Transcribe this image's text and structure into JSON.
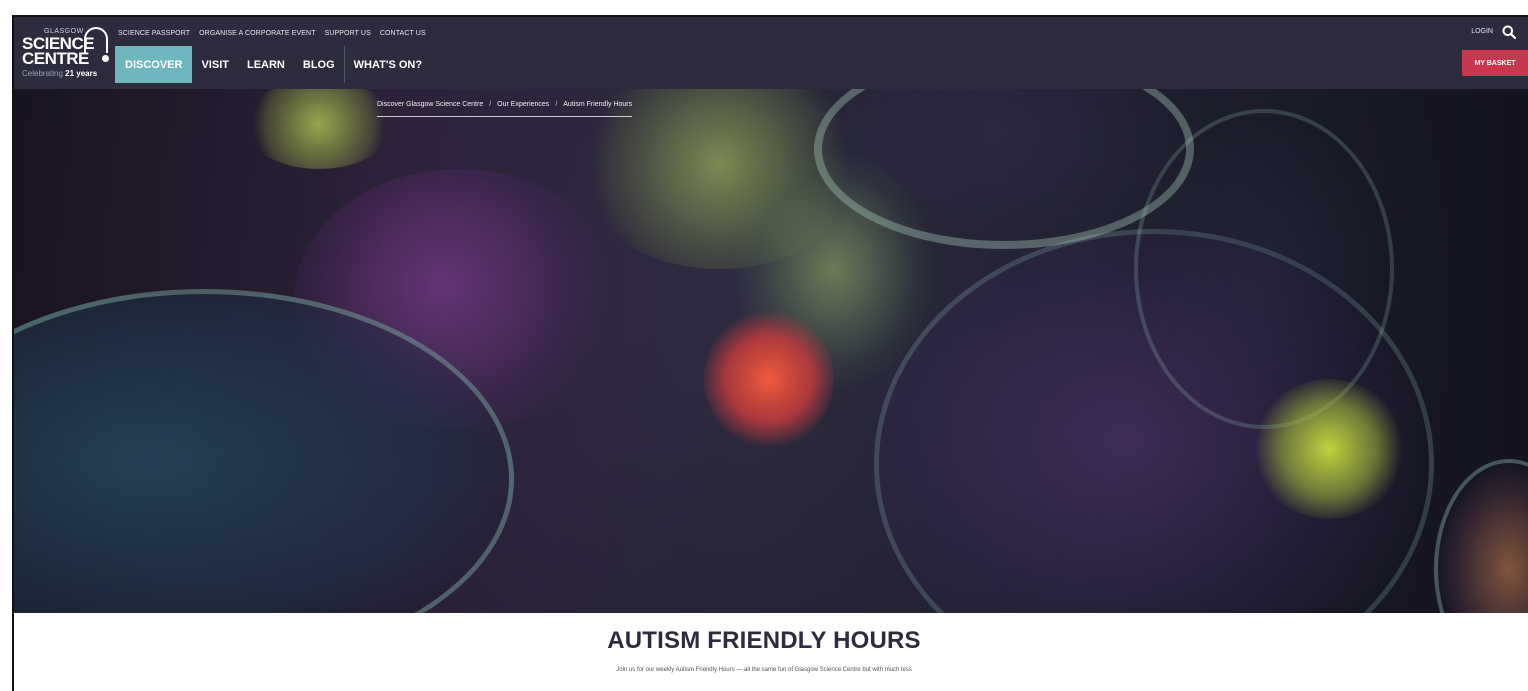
{
  "logo": {
    "line1": "GLASGOW",
    "line2": "SCIENCE",
    "line3": "CENTRE",
    "tagline_prefix": "Celebrating",
    "tagline_bold": "21 years"
  },
  "utility_nav": [
    "SCIENCE PASSPORT",
    "ORGANISE A CORPORATE EVENT",
    "SUPPORT US",
    "CONTACT US"
  ],
  "main_nav": [
    "DISCOVER",
    "VISIT",
    "LEARN",
    "BLOG",
    "WHAT'S ON?"
  ],
  "header_right": {
    "login": "LOGIN",
    "basket": "MY BASKET"
  },
  "breadcrumb": {
    "items": [
      "Discover Glasgow Science Centre",
      "Our Experiences",
      "Autism Friendly Hours"
    ],
    "separator": "/"
  },
  "page": {
    "title": "AUTISM FRIENDLY HOURS",
    "intro": "Join us for our weekly Autism Friendly Hours — all the same fun of Glasgow Science Centre but with much less"
  },
  "colors": {
    "header_bg": "#2c2c3e",
    "active_tab": "#6fb6be",
    "basket": "#c9374f"
  }
}
